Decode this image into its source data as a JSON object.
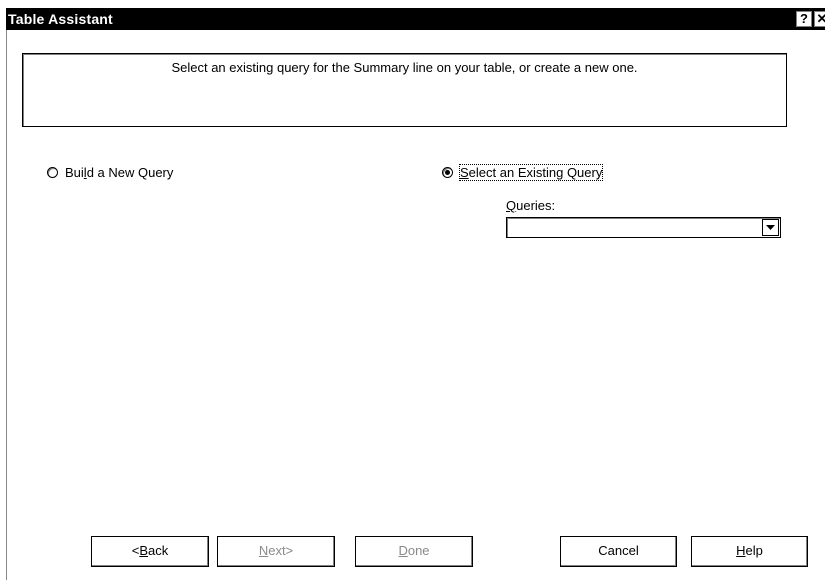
{
  "window": {
    "title": "Table Assistant",
    "help_glyph": "?",
    "close_glyph": "✕"
  },
  "instructions": "Select an existing query for the Summary line on your table, or create a new one.",
  "options": {
    "build_new": {
      "label_pre": "Bui",
      "mnemonic": "l",
      "label_post": "d a New Query",
      "selected": false
    },
    "select_existing": {
      "label_pre": "",
      "mnemonic": "S",
      "label_post": "elect an Existing Query",
      "selected": true
    }
  },
  "queries": {
    "label_mnemonic": "Q",
    "label_rest": "ueries:",
    "value": ""
  },
  "buttons": {
    "back": {
      "pre": "<",
      "mnemonic": "B",
      "post": "ack",
      "enabled": true
    },
    "next": {
      "pre": "",
      "mnemonic": "N",
      "post": "ext>",
      "enabled": false
    },
    "done": {
      "pre": "",
      "mnemonic": "D",
      "post": "one",
      "enabled": false
    },
    "cancel": {
      "pre": "Cancel",
      "mnemonic": "",
      "post": "",
      "enabled": true
    },
    "help": {
      "pre": "",
      "mnemonic": "H",
      "post": "elp",
      "enabled": true
    }
  },
  "icons": {
    "help": "question-mark-icon",
    "close": "close-icon",
    "dropdown": "chevron-down-icon"
  }
}
